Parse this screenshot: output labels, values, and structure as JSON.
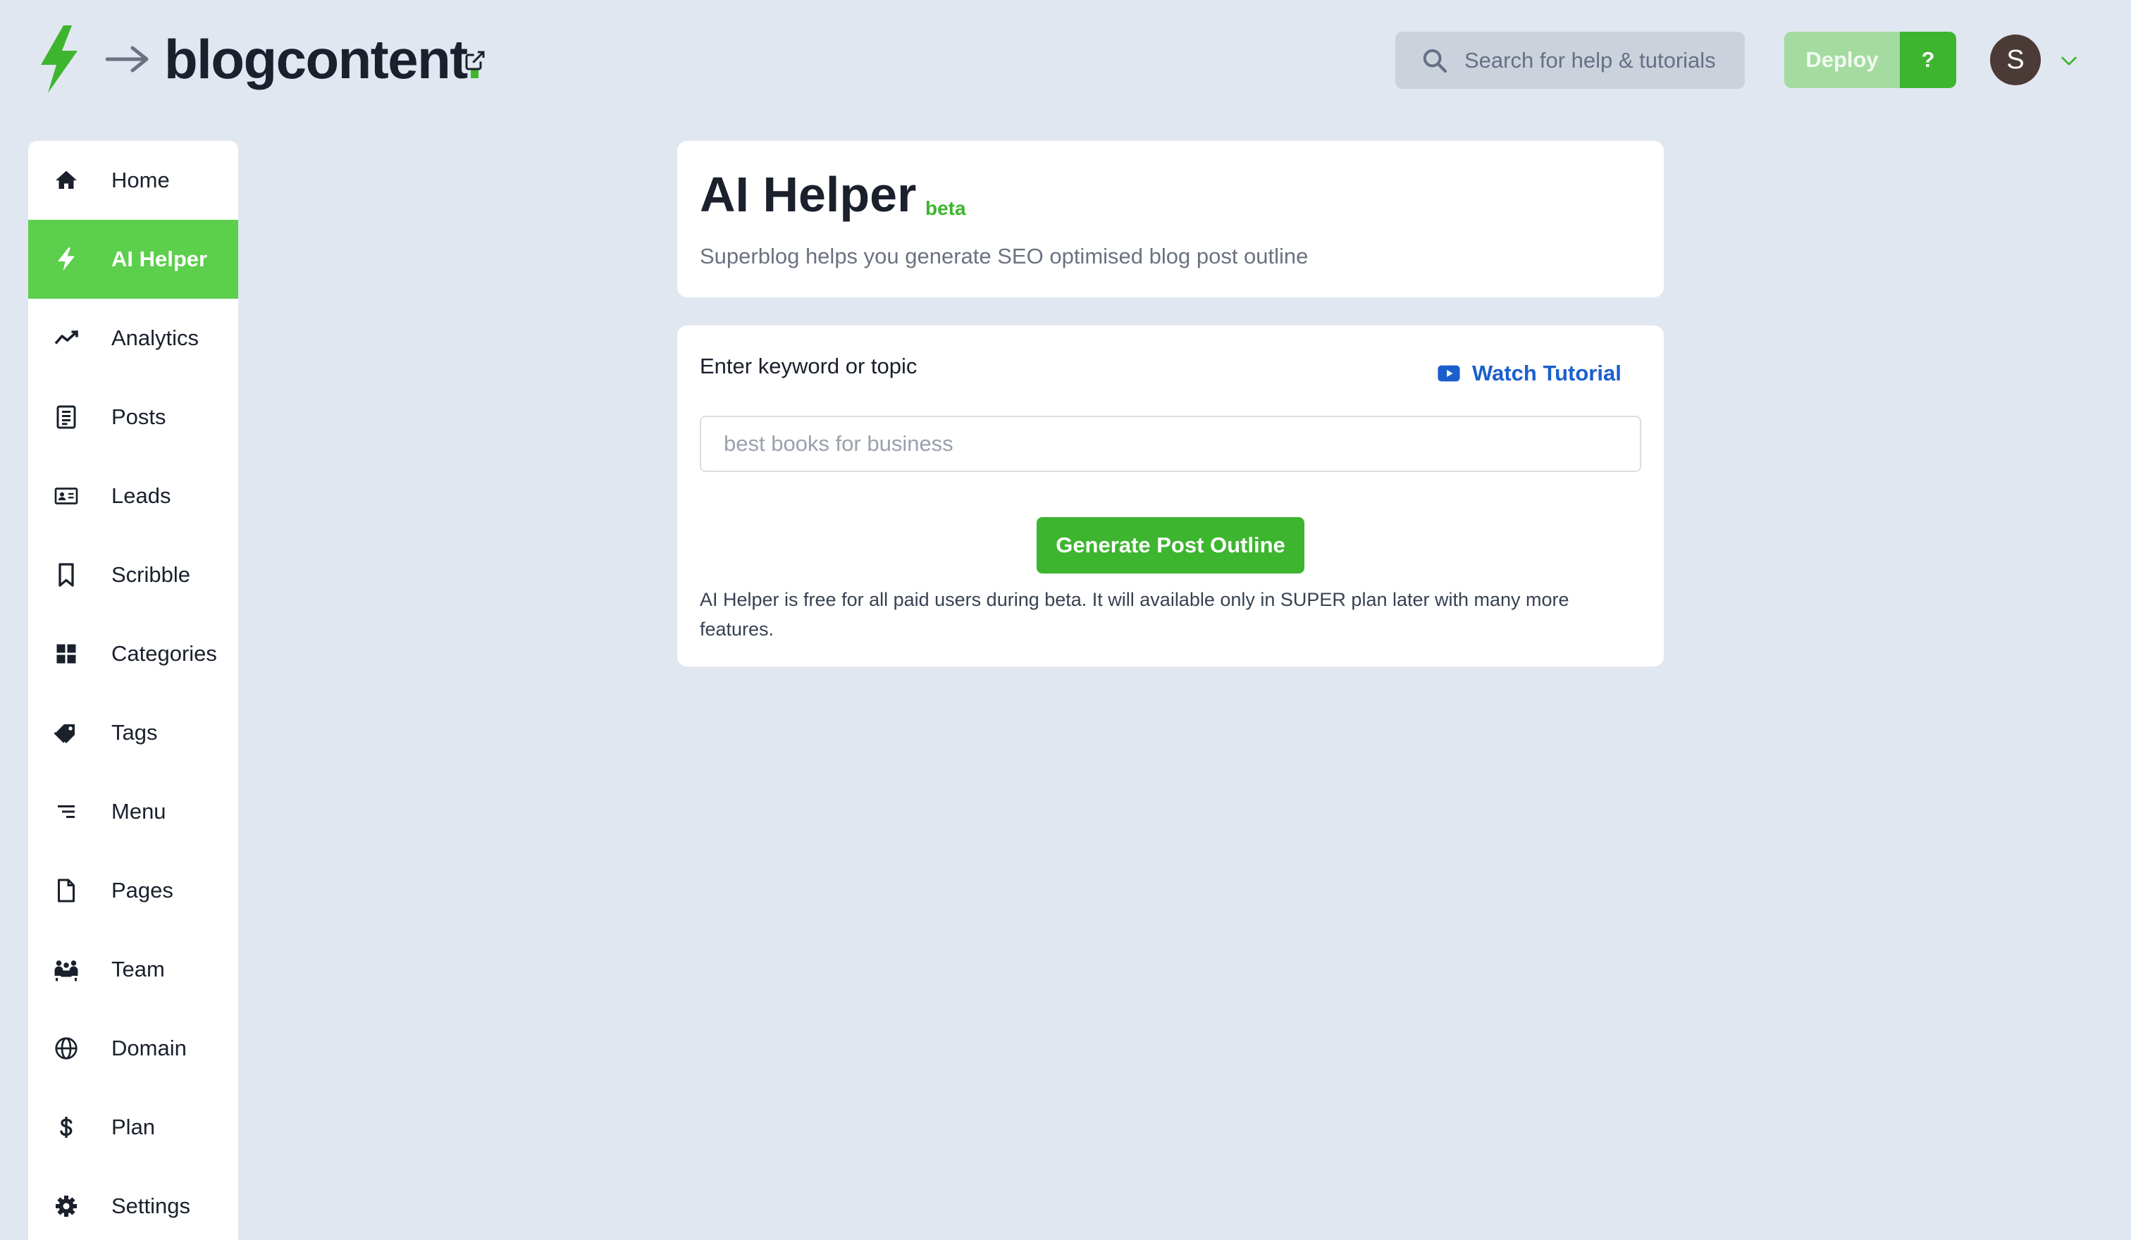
{
  "header": {
    "site_name": "blogcontent",
    "site_name_dot": ".",
    "search_placeholder": "Search for help & tutorials",
    "deploy_label": "Deploy",
    "help_label": "?",
    "avatar_initial": "S"
  },
  "sidebar": {
    "items": [
      {
        "label": "Home",
        "icon": "home-icon"
      },
      {
        "label": "AI Helper",
        "icon": "bolt-icon",
        "active": true
      },
      {
        "label": "Analytics",
        "icon": "trend-icon"
      },
      {
        "label": "Posts",
        "icon": "document-icon"
      },
      {
        "label": "Leads",
        "icon": "contact-card-icon"
      },
      {
        "label": "Scribble",
        "icon": "bookmark-icon"
      },
      {
        "label": "Categories",
        "icon": "grid-icon"
      },
      {
        "label": "Tags",
        "icon": "tags-icon"
      },
      {
        "label": "Menu",
        "icon": "menu-lines-icon"
      },
      {
        "label": "Pages",
        "icon": "page-icon"
      },
      {
        "label": "Team",
        "icon": "team-icon"
      },
      {
        "label": "Domain",
        "icon": "globe-icon"
      },
      {
        "label": "Plan",
        "icon": "dollar-icon"
      },
      {
        "label": "Settings",
        "icon": "gear-icon"
      }
    ]
  },
  "main": {
    "title": "AI Helper",
    "badge": "beta",
    "subtitle": "Superblog helps you generate SEO optimised blog post outline",
    "form": {
      "label": "Enter keyword or topic",
      "tutorial_label": "Watch Tutorial",
      "input_value": "",
      "input_placeholder": "best books for business",
      "button_label": "Generate Post Outline",
      "note": "AI Helper is free for all paid users during beta. It will available only in SUPER plan later with many more features."
    }
  },
  "colors": {
    "background": "#e1e7f0",
    "accent_green": "#3db52f",
    "active_nav": "#5ccf4c",
    "link_blue": "#1a5fcc"
  }
}
